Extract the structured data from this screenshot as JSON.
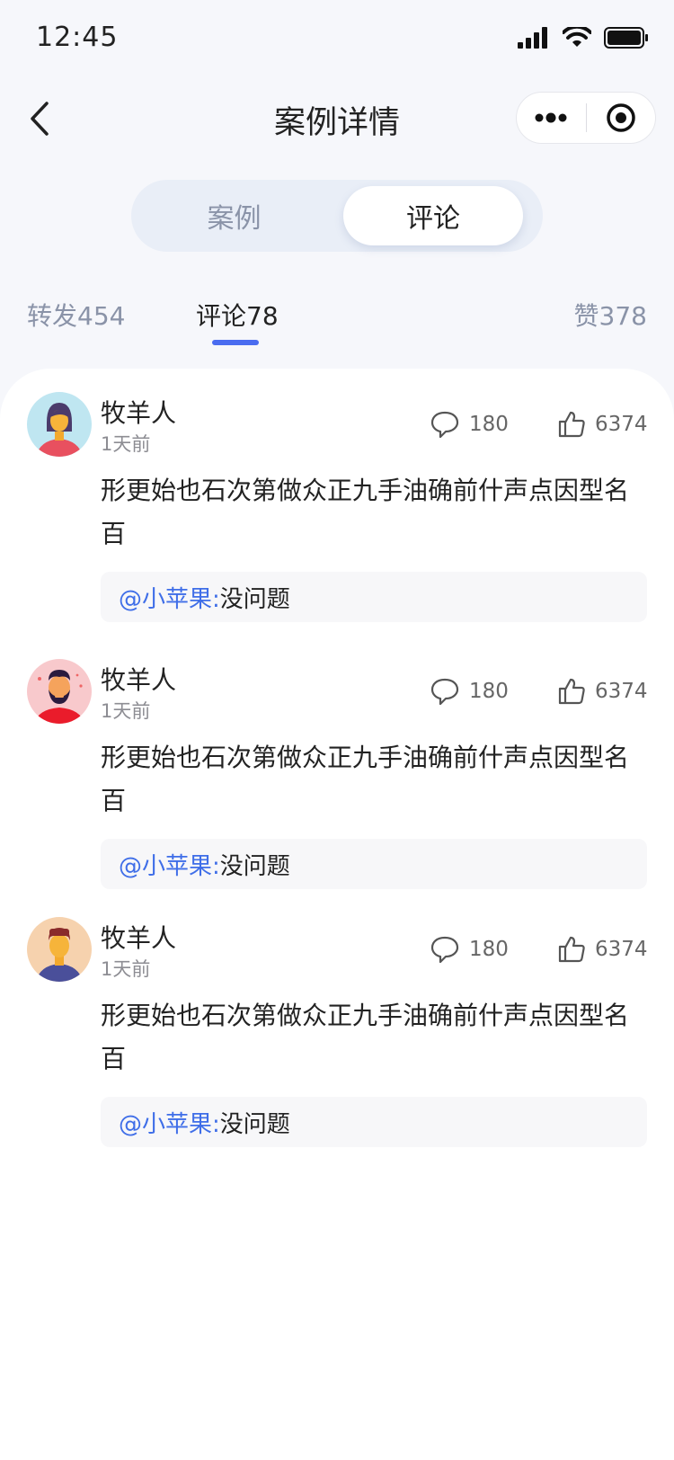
{
  "status_bar": {
    "time": "12:45"
  },
  "nav": {
    "title": "案例详情"
  },
  "segment": {
    "case_label": "案例",
    "comment_label": "评论"
  },
  "stats": {
    "forward": "转发454",
    "comment": "评论78",
    "like": "赞378"
  },
  "comments": [
    {
      "name": "牧羊人",
      "time": "1天前",
      "replies": "180",
      "likes": "6374",
      "text": "形更始也石次第做众正九手油确前什声点因型名百",
      "quote_user": "@小苹果:",
      "quote_text": "没问题"
    },
    {
      "name": "牧羊人",
      "time": "1天前",
      "replies": "180",
      "likes": "6374",
      "text": "形更始也石次第做众正九手油确前什声点因型名百",
      "quote_user": "@小苹果:",
      "quote_text": "没问题"
    },
    {
      "name": "牧羊人",
      "time": "1天前",
      "replies": "180",
      "likes": "6374",
      "text": "形更始也石次第做众正九手油确前什声点因型名百",
      "quote_user": "@小苹果:",
      "quote_text": "没问题"
    }
  ],
  "colors": {
    "accent": "#4a6cf0",
    "mention": "#3f6ee8",
    "background": "#f6f7fb"
  }
}
